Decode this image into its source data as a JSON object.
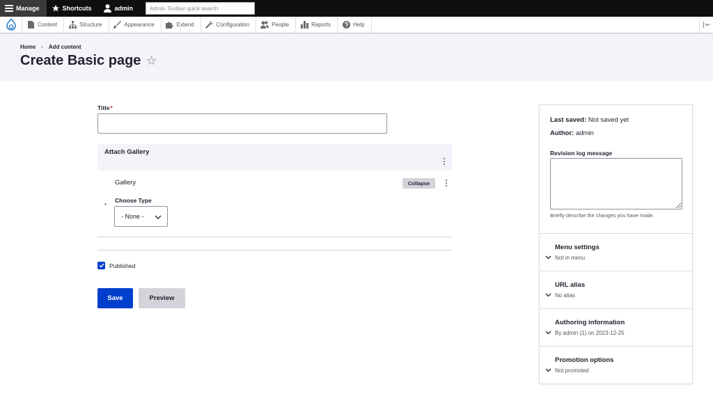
{
  "toolbar": {
    "manage_label": "Manage",
    "shortcuts_label": "Shortcuts",
    "user_label": "admin",
    "search_placeholder": "Admin Toolbar quick search"
  },
  "tray": {
    "items": [
      "Content",
      "Structure",
      "Appearance",
      "Extend",
      "Configuration",
      "People",
      "Reports",
      "Help"
    ]
  },
  "breadcrumb": [
    "Home",
    "Add content"
  ],
  "breadcrumb_separator": "›",
  "page_title": "Create Basic page",
  "form": {
    "title_label": "Title",
    "required_marker": "*",
    "title_value": "",
    "attach_gallery_label": "Attach Gallery",
    "gallery_label": "Gallery",
    "collapse_label": "Collapse",
    "bullet": "•",
    "choose_type_label": "Choose Type",
    "choose_type_value": "- None -",
    "published_label": "Published",
    "published_checked": true,
    "save_label": "Save",
    "preview_label": "Preview"
  },
  "sidebar": {
    "last_saved_label": "Last saved:",
    "last_saved_value": "Not saved yet",
    "author_label": "Author:",
    "author_value": "admin",
    "revision_label": "Revision log message",
    "revision_value": "",
    "revision_help": "Briefly describe the changes you have made.",
    "sections": [
      {
        "title": "Menu settings",
        "summary": "Not in menu"
      },
      {
        "title": "URL alias",
        "summary": "No alias"
      },
      {
        "title": "Authoring information",
        "summary": "By admin (1) on 2023-12-25"
      },
      {
        "title": "Promotion options",
        "summary": "Not promoted"
      }
    ]
  },
  "colors": {
    "primary_button": "#003ecc",
    "header_bg": "#f3f4f9",
    "toolbar_bg": "#0f0f0f",
    "required": "#dc2323"
  }
}
